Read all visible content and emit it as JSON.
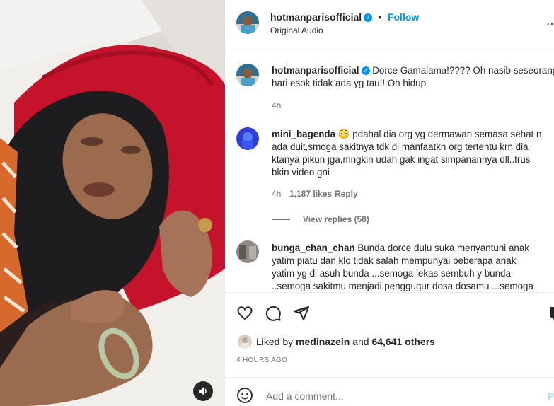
{
  "post": {
    "username": "hotmanparisofficial",
    "follow_label": "Follow",
    "audio_label": "Original Audio"
  },
  "caption": {
    "username": "hotmanparisofficial",
    "text_line1": "Dorce Gamalama!???? Oh nasib seseorang",
    "text_line2": "hari esok tidak ada yg tau!! Oh hidup",
    "time": "4h"
  },
  "comments": [
    {
      "username": "mini_bagenda",
      "emoji": "😳",
      "line1": "pdahal dia org yg dermawan semasa sehat n",
      "line2": "ada duit,smoga sakitnya tdk di manfaatkn org tertentu krn dia",
      "line3": "ktanya pikun jga,mngkin udah gak ingat simpanannya dll..trus",
      "line4": "bkin video gni",
      "time": "4h",
      "likes": "1,187 likes",
      "reply_label": "Reply",
      "view_replies": "View replies (58)"
    },
    {
      "username": "bunga_chan_chan",
      "line1": "Bunda dorce dulu suka menyantuni anak",
      "line2": "yatim piatu dan klo tidak salah mempunyai beberapa anak",
      "line3": "yatim yg di asuh bunda ...semoga lekas sembuh y bunda",
      "line4": "..semoga sakitmu menjadi penggugur dosa dosamu ...semoga"
    }
  ],
  "likes": {
    "prefix": "Liked by ",
    "user": "medinazein",
    "middle": " and ",
    "count": "64,641 others"
  },
  "timestamp": "4 HOURS AGO",
  "comment_box": {
    "placeholder": "Add a comment...",
    "post_label": "P"
  },
  "colors": {
    "accent": "#0095f6",
    "muted": "#737373",
    "text": "#262626"
  }
}
